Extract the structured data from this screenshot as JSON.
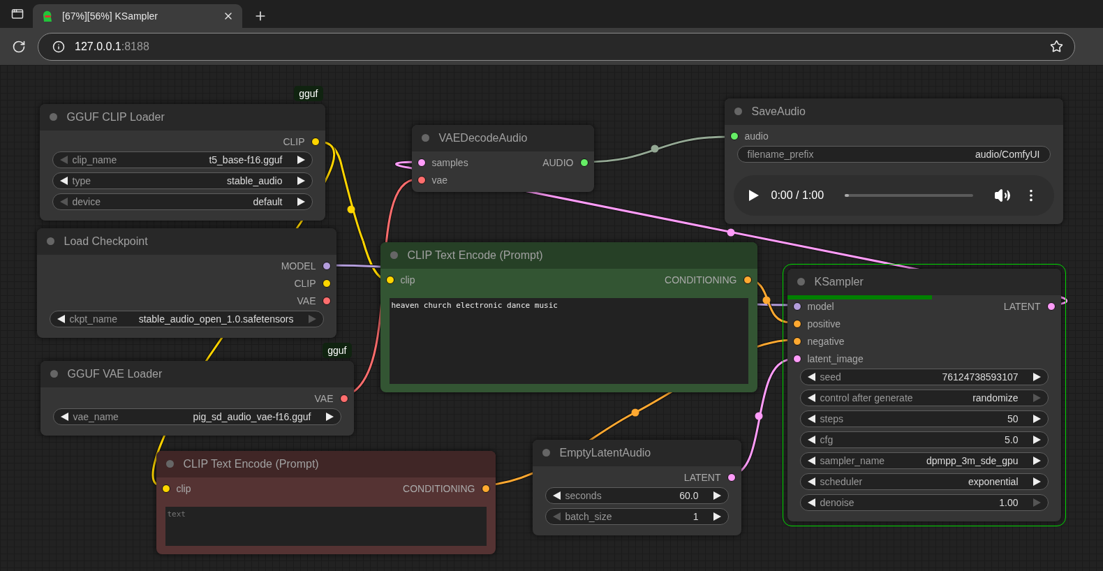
{
  "browser": {
    "tab": {
      "title": "[67%][56%] KSampler",
      "selected": true
    },
    "address": {
      "host": "127.0.0.1",
      "port": ":8188"
    }
  },
  "nodes": [
    {
      "title": "GGUF CLIP Loader",
      "color": "#353535",
      "badge": "gguf",
      "selected": false,
      "outputs": [
        {
          "label": "CLIP",
          "color": "#ffd500"
        }
      ],
      "widgets": [
        {
          "kind": "combo",
          "label": "clip_name",
          "value": "t5_base-f16.gguf",
          "prev_disabled": true,
          "next_disabled": false
        },
        {
          "kind": "combo",
          "label": "type",
          "value": "stable_audio",
          "prev_disabled": false,
          "next_disabled": false
        },
        {
          "kind": "combo",
          "label": "device",
          "value": "default",
          "prev_disabled": true,
          "next_disabled": false
        }
      ]
    },
    {
      "title": "Load Checkpoint",
      "color": "#353535",
      "selected": false,
      "outputs": [
        {
          "label": "MODEL",
          "color": "#b39ddb"
        },
        {
          "label": "CLIP",
          "color": "#ffd500"
        },
        {
          "label": "VAE",
          "color": "#ff6e6e"
        }
      ],
      "widgets": [
        {
          "kind": "combo",
          "label": "ckpt_name",
          "value": "stable_audio_open_1.0.safetensors",
          "prev_disabled": false,
          "next_disabled": true
        }
      ]
    },
    {
      "title": "GGUF VAE Loader",
      "color": "#353535",
      "badge": "gguf",
      "selected": false,
      "outputs": [
        {
          "label": "VAE",
          "color": "#ff6e6e"
        }
      ],
      "widgets": [
        {
          "kind": "combo",
          "label": "vae_name",
          "value": "pig_sd_audio_vae-f16.gguf",
          "prev_disabled": false,
          "next_disabled": false
        }
      ]
    },
    {
      "title": "VAEDecodeAudio",
      "color": "#353535",
      "selected": false,
      "inputs": [
        {
          "label": "samples",
          "color": "#ff9cf9"
        },
        {
          "label": "vae",
          "color": "#ff6e6e"
        }
      ],
      "outputs": [
        {
          "label": "AUDIO",
          "color": "#66ee66"
        }
      ]
    },
    {
      "title": "CLIP Text Encode (Prompt)",
      "color": "#335533",
      "selected": false,
      "inputs": [
        {
          "label": "clip",
          "color": "#ffd500"
        }
      ],
      "outputs": [
        {
          "label": "CONDITIONING",
          "color": "#ffa931"
        }
      ],
      "widgets": [
        {
          "kind": "textarea",
          "value": "heaven church electronic dance music"
        }
      ]
    },
    {
      "title": "SaveAudio",
      "color": "#353535",
      "selected": false,
      "inputs": [
        {
          "label": "audio",
          "color": "#66ee66"
        }
      ],
      "widgets": [
        {
          "kind": "text",
          "label": "filename_prefix",
          "value": "audio/ComfyUI"
        },
        {
          "kind": "audio",
          "time": "0:00 / 1:00",
          "level": 0.03
        }
      ]
    },
    {
      "title": "KSampler",
      "color": "#353535",
      "selected": true,
      "progress": {
        "level": 0.53
      },
      "inputs": [
        {
          "label": "model",
          "color": "#b39ddb"
        },
        {
          "label": "positive",
          "color": "#ffa931"
        },
        {
          "label": "negative",
          "color": "#ffa931"
        },
        {
          "label": "latent_image",
          "color": "#ff9cf9"
        }
      ],
      "outputs": [
        {
          "label": "LATENT",
          "color": "#ff9cf9"
        }
      ],
      "widgets": [
        {
          "kind": "combo",
          "label": "seed",
          "value": "76124738593107",
          "prev_disabled": false,
          "next_disabled": false
        },
        {
          "kind": "combo",
          "label": "control after generate",
          "value": "randomize",
          "prev_disabled": false,
          "next_disabled": true
        },
        {
          "kind": "combo",
          "label": "steps",
          "value": "50",
          "prev_disabled": false,
          "next_disabled": false
        },
        {
          "kind": "combo",
          "label": "cfg",
          "value": "5.0",
          "prev_disabled": false,
          "next_disabled": false
        },
        {
          "kind": "combo",
          "label": "sampler_name",
          "value": "dpmpp_3m_sde_gpu",
          "prev_disabled": false,
          "next_disabled": false
        },
        {
          "kind": "combo",
          "label": "scheduler",
          "value": "exponential",
          "prev_disabled": false,
          "next_disabled": false
        },
        {
          "kind": "combo",
          "label": "denoise",
          "value": "1.00",
          "prev_disabled": false,
          "next_disabled": true
        }
      ]
    },
    {
      "title": "CLIP Text Encode (Prompt)",
      "color": "#553333",
      "selected": false,
      "inputs": [
        {
          "label": "clip",
          "color": "#ffd500"
        }
      ],
      "outputs": [
        {
          "label": "CONDITIONING",
          "color": "#ffa931"
        }
      ],
      "widgets": [
        {
          "kind": "textarea",
          "placeholder": "text"
        }
      ]
    },
    {
      "title": "EmptyLatentAudio",
      "color": "#353535",
      "selected": false,
      "outputs": [
        {
          "label": "LATENT",
          "color": "#ff9cf9"
        }
      ],
      "widgets": [
        {
          "kind": "combo",
          "label": "seconds",
          "value": "60.0",
          "prev_disabled": false,
          "next_disabled": false
        },
        {
          "kind": "combo",
          "label": "batch_size",
          "value": "1",
          "prev_disabled": true,
          "next_disabled": false
        }
      ]
    }
  ]
}
